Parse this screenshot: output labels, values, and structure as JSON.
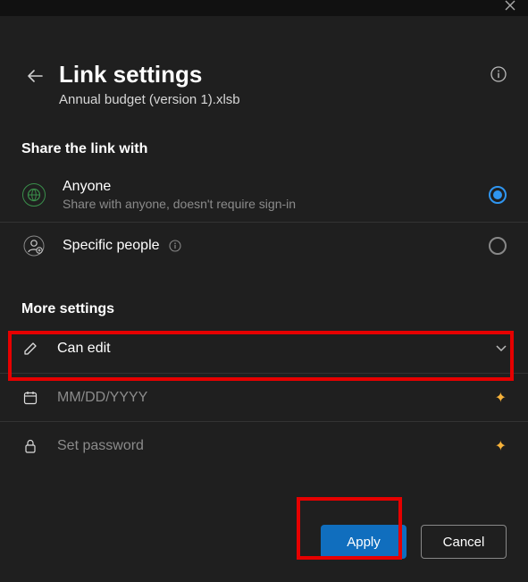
{
  "header": {
    "title": "Link settings",
    "filename": "Annual budget (version 1).xlsb"
  },
  "share_section": {
    "label": "Share the link with",
    "options": [
      {
        "title": "Anyone",
        "desc": "Share with anyone, doesn't require sign-in",
        "selected": true,
        "icon": "globe"
      },
      {
        "title": "Specific people",
        "desc": "",
        "selected": false,
        "icon": "people"
      }
    ]
  },
  "more_settings": {
    "label": "More settings",
    "permission": "Can edit",
    "expiry_placeholder": "MM/DD/YYYY",
    "password_placeholder": "Set password"
  },
  "footer": {
    "apply": "Apply",
    "cancel": "Cancel"
  }
}
